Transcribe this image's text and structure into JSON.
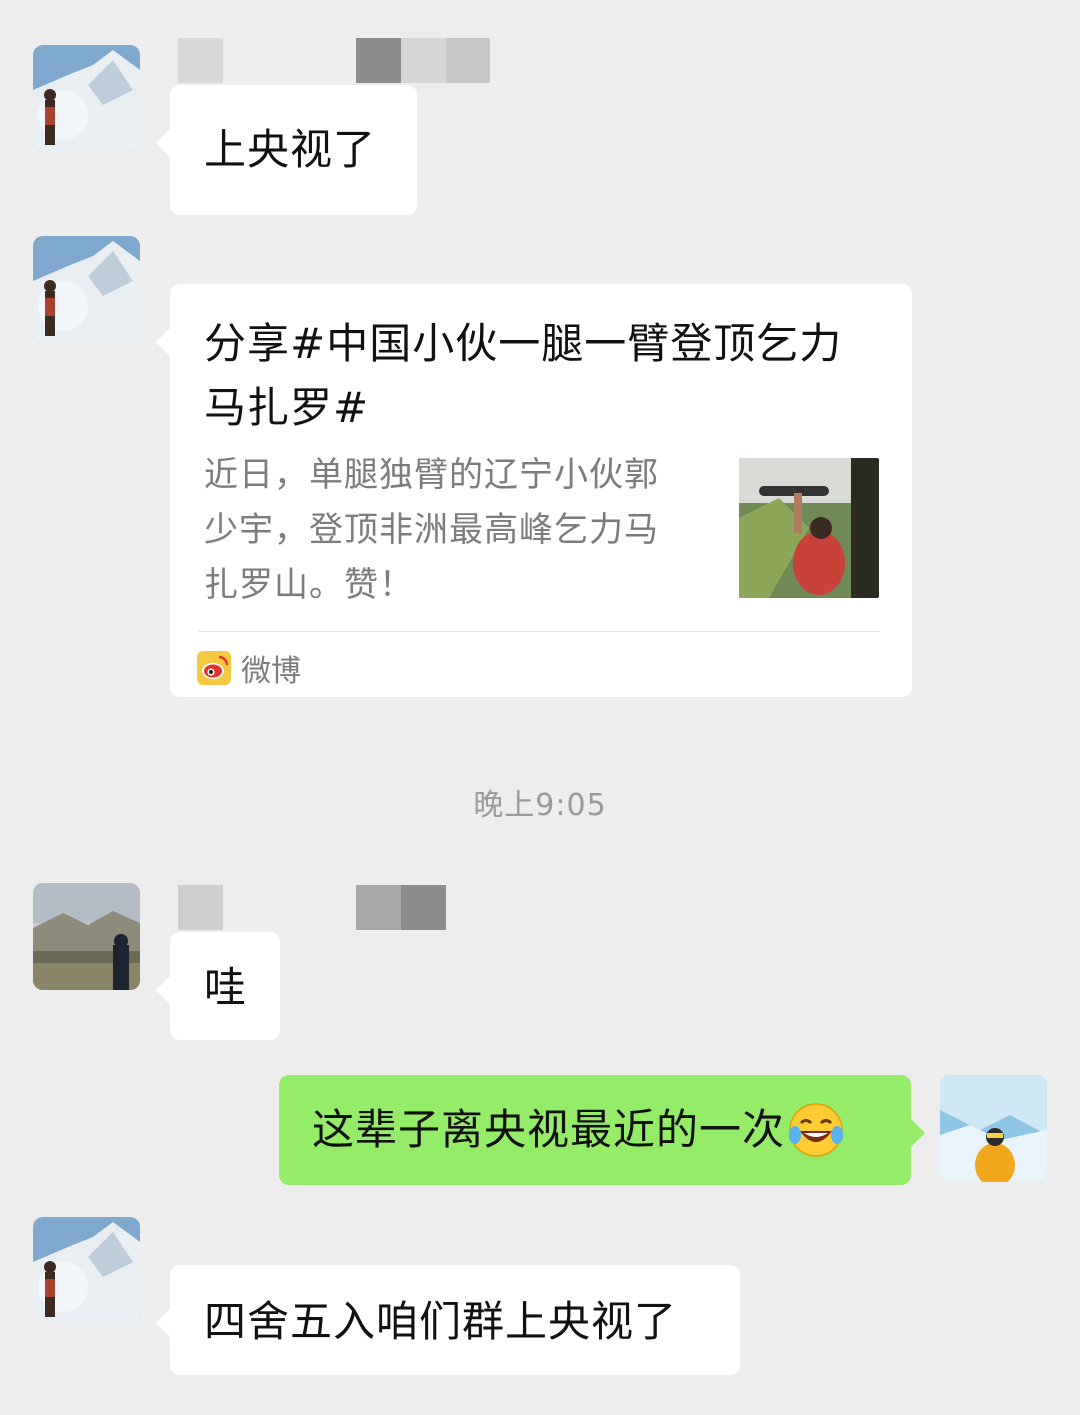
{
  "messages": [
    {
      "text": "上央视了"
    },
    {
      "card": {
        "title": "分享#中国小伙一腿一臂登顶乞力马扎罗#",
        "description": "近日，单腿独臂的辽宁小伙郭少宇，登顶非洲最高峰乞力马扎罗山。赞！",
        "source": "微博"
      }
    },
    {
      "text": "哇"
    },
    {
      "text": "这辈子离央视最近的一次",
      "emoji": "laughing-tears-icon"
    },
    {
      "text": "四舍五入咱们群上央视了"
    }
  ],
  "timestamp": "晚上9:05",
  "colors": {
    "background": "#ededed",
    "bubble_incoming": "#ffffff",
    "bubble_outgoing": "#95ec69",
    "secondary_text": "#7c7c7c"
  }
}
